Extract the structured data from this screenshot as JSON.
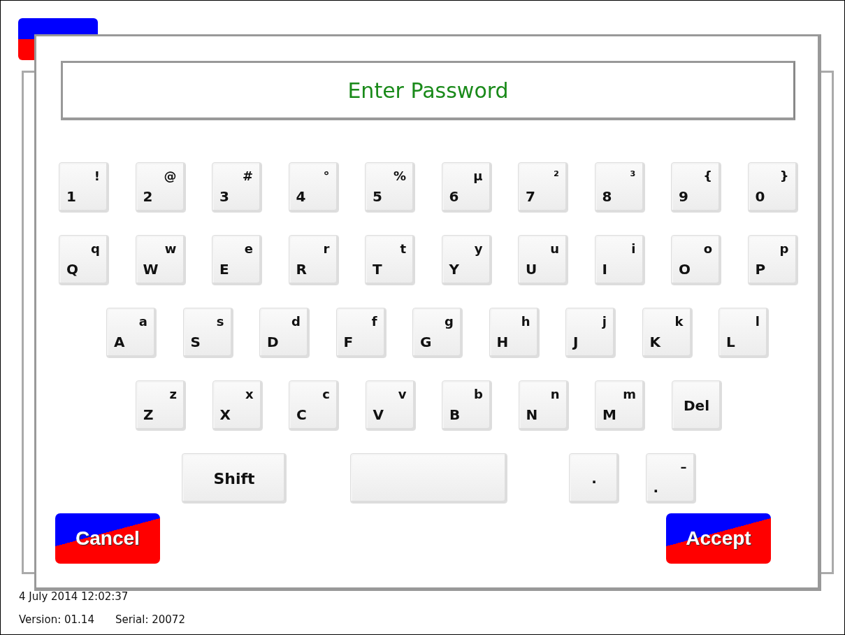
{
  "dialog": {
    "title": "Enter Password",
    "key_rows": [
      [
        {
          "main": "1",
          "alt": "!"
        },
        {
          "main": "2",
          "alt": "@"
        },
        {
          "main": "3",
          "alt": "#"
        },
        {
          "main": "4",
          "alt": "°"
        },
        {
          "main": "5",
          "alt": "%"
        },
        {
          "main": "6",
          "alt": "µ"
        },
        {
          "main": "7",
          "alt": "²"
        },
        {
          "main": "8",
          "alt": "³"
        },
        {
          "main": "9",
          "alt": "{"
        },
        {
          "main": "0",
          "alt": "}"
        }
      ],
      [
        {
          "main": "Q",
          "alt": "q"
        },
        {
          "main": "W",
          "alt": "w"
        },
        {
          "main": "E",
          "alt": "e"
        },
        {
          "main": "R",
          "alt": "r"
        },
        {
          "main": "T",
          "alt": "t"
        },
        {
          "main": "Y",
          "alt": "y"
        },
        {
          "main": "U",
          "alt": "u"
        },
        {
          "main": "I",
          "alt": "i"
        },
        {
          "main": "O",
          "alt": "o"
        },
        {
          "main": "P",
          "alt": "p"
        }
      ],
      [
        {
          "main": "A",
          "alt": "a"
        },
        {
          "main": "S",
          "alt": "s"
        },
        {
          "main": "D",
          "alt": "d"
        },
        {
          "main": "F",
          "alt": "f"
        },
        {
          "main": "G",
          "alt": "g"
        },
        {
          "main": "H",
          "alt": "h"
        },
        {
          "main": "J",
          "alt": "j"
        },
        {
          "main": "K",
          "alt": "k"
        },
        {
          "main": "L",
          "alt": "l"
        }
      ],
      [
        {
          "main": "Z",
          "alt": "z"
        },
        {
          "main": "X",
          "alt": "x"
        },
        {
          "main": "C",
          "alt": "c"
        },
        {
          "main": "V",
          "alt": "v"
        },
        {
          "main": "B",
          "alt": "b"
        },
        {
          "main": "N",
          "alt": "n"
        },
        {
          "main": "M",
          "alt": "m"
        },
        {
          "kind": "label",
          "label": "Del"
        }
      ],
      [
        {
          "kind": "wide",
          "label": "Shift"
        },
        {
          "kind": "space"
        },
        {
          "kind": "center",
          "label": "."
        },
        {
          "main": ".",
          "alt": "–"
        }
      ]
    ],
    "buttons": [
      {
        "label": "Cancel"
      },
      {
        "label": "Accept"
      }
    ]
  },
  "status": {
    "date": "4 July 2014  12:02:37",
    "version": "Version: 01.14",
    "serial": "Serial: 20072"
  }
}
